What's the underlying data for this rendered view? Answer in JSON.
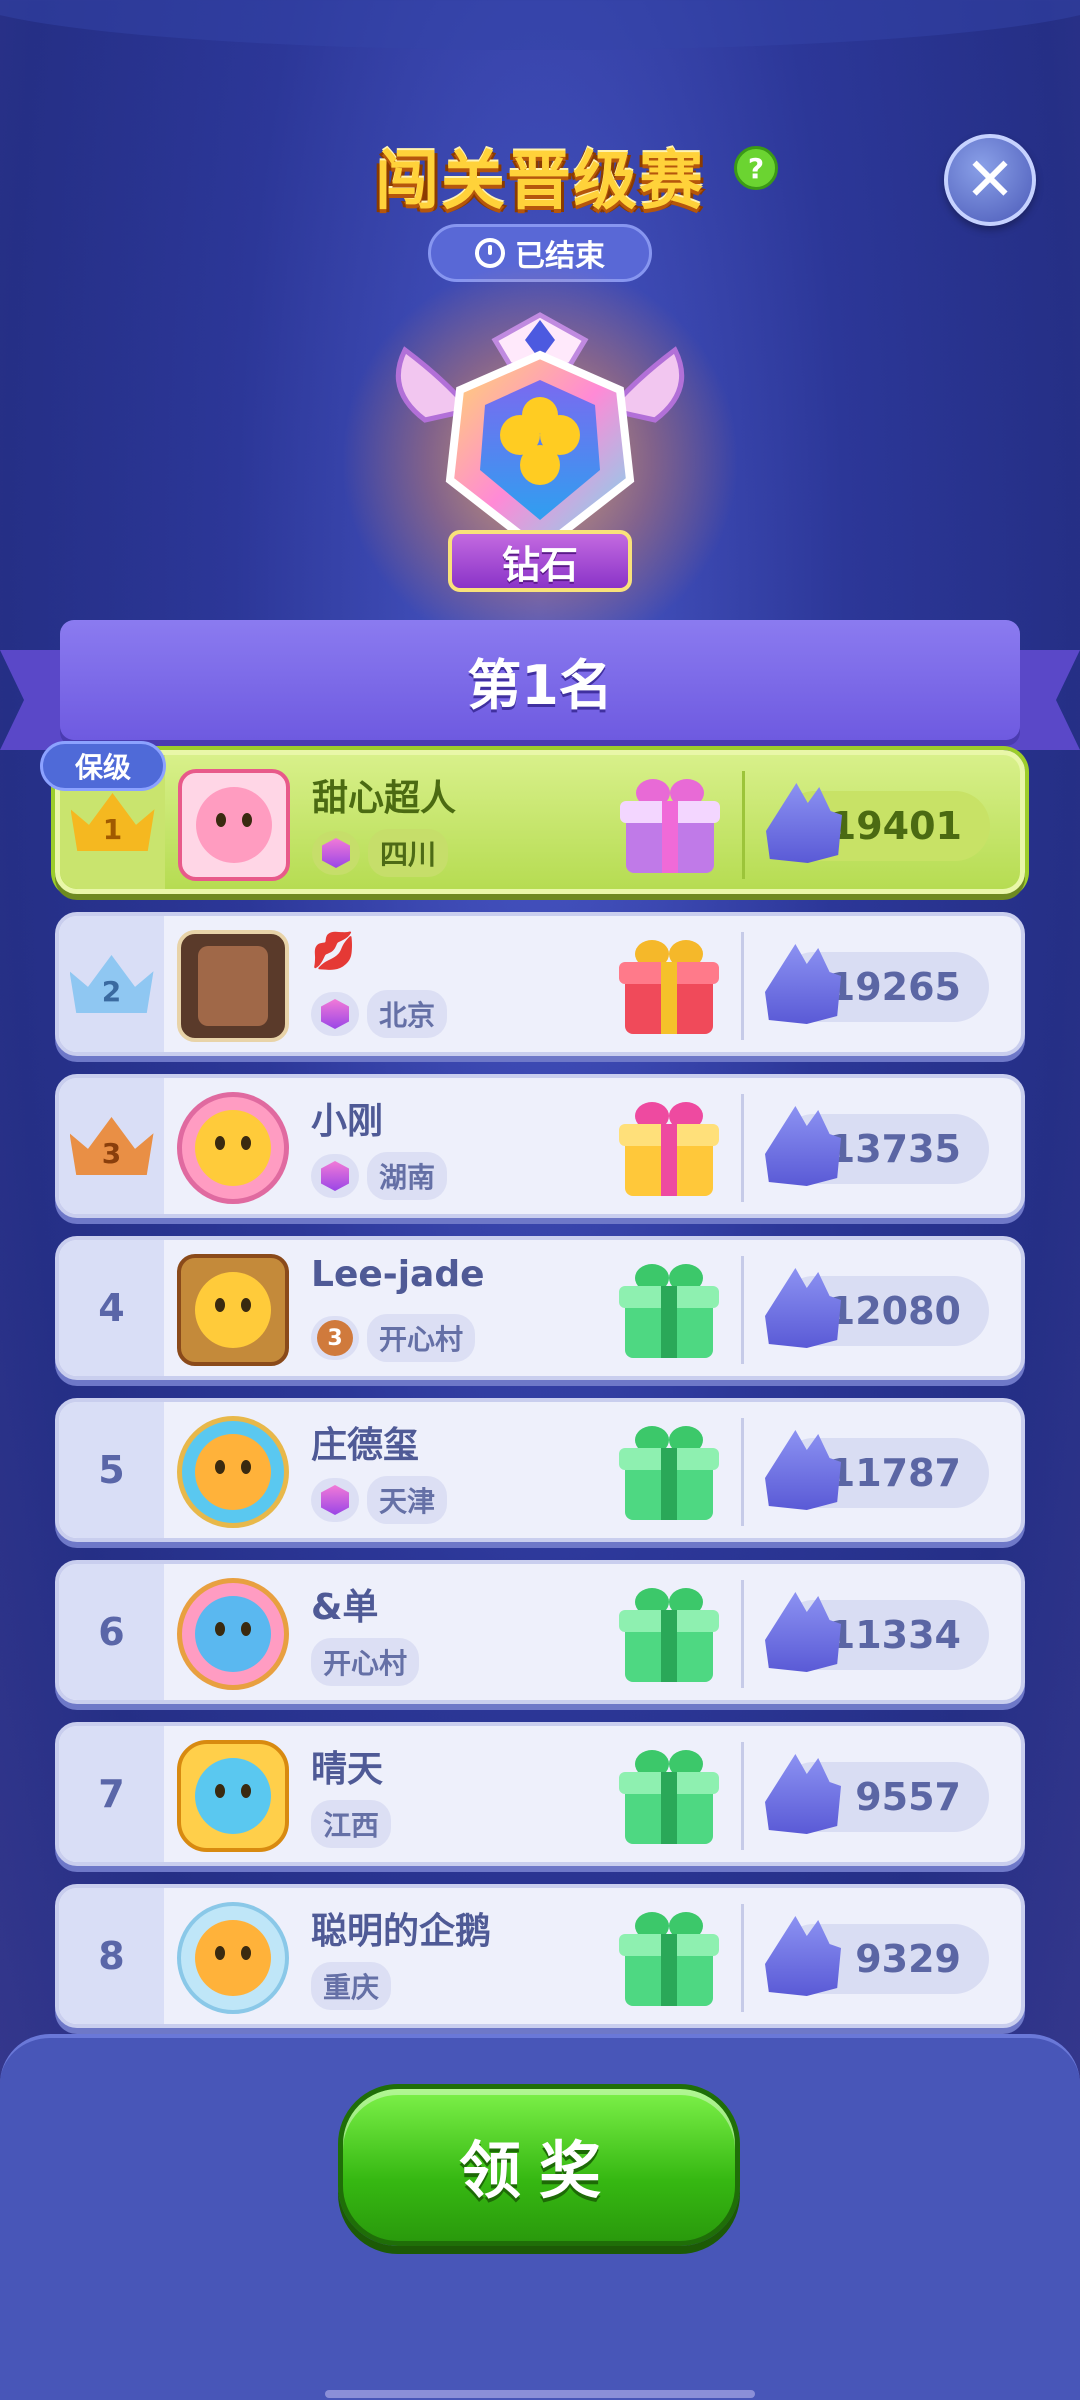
{
  "header": {
    "title": "闯关晋级赛",
    "status": "已结束"
  },
  "badge": {
    "tier": "钻石"
  },
  "banner": {
    "rank_text": "第1名"
  },
  "rows": [
    {
      "rank": "1",
      "name": "甜心超人",
      "location": "四川",
      "score": "19401",
      "tag": "保级",
      "gift": "purple",
      "avatar": "pink"
    },
    {
      "rank": "2",
      "name": "💋",
      "location": "北京",
      "score": "19265",
      "gift": "red",
      "avatar": "photo"
    },
    {
      "rank": "3",
      "name": "小刚",
      "location": "湖南",
      "score": "13735",
      "gift": "yellow",
      "avatar": "yellow"
    },
    {
      "rank": "4",
      "name": "Lee-jade",
      "location": "开心村",
      "score": "12080",
      "level": "3",
      "gift": "green",
      "avatar": "orange"
    },
    {
      "rank": "5",
      "name": "庄德玺",
      "location": "天津",
      "score": "11787",
      "gift": "green",
      "avatar": "blue"
    },
    {
      "rank": "6",
      "name": "&单",
      "location": "开心村",
      "score": "11334",
      "gift": "green",
      "avatar": "blue"
    },
    {
      "rank": "7",
      "name": "晴天",
      "location": "江西",
      "score": "9557",
      "gift": "green",
      "avatar": "gold"
    },
    {
      "rank": "8",
      "name": "聪明的企鹅",
      "location": "重庆",
      "score": "9329",
      "gift": "green",
      "avatar": "winter"
    }
  ],
  "footer": {
    "claim_label": "领奖"
  },
  "colors": {
    "gold_crown": "#f5b820",
    "silver_crown": "#8fc7f2",
    "bronze_crown": "#e98f45"
  }
}
